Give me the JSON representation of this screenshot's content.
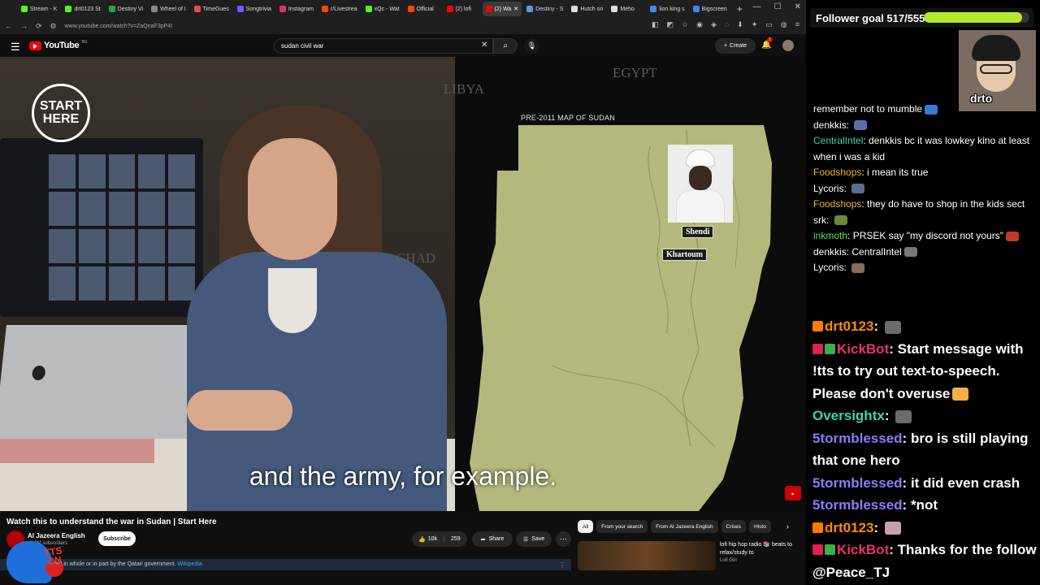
{
  "browser": {
    "tabs": [
      {
        "label": "Stream - K",
        "color": "#53fc18"
      },
      {
        "label": "drt0123 St",
        "color": "#53fc18"
      },
      {
        "label": "Destiny Vi",
        "color": "#26a641"
      },
      {
        "label": "Wheel of I",
        "color": "#888888"
      },
      {
        "label": "TimeGues",
        "color": "#e24c4c"
      },
      {
        "label": "Songtrivia",
        "color": "#6b5cff"
      },
      {
        "label": "Instagram",
        "color": "#e1306c"
      },
      {
        "label": "r/Livestrea",
        "color": "#ff4500"
      },
      {
        "label": "xQc - Wat",
        "color": "#53fc18"
      },
      {
        "label": "Official",
        "color": "#ff4500"
      },
      {
        "label": "(2) lofi",
        "color": "#ff0000"
      },
      {
        "label": "(2) Wa",
        "color": "#ff0000",
        "active": true
      },
      {
        "label": "Destiny - S",
        "color": "#5b9bd5"
      },
      {
        "label": "Hutch on",
        "color": "#dddddd"
      },
      {
        "label": "Meho",
        "color": "#dddddd"
      },
      {
        "label": "lion king s",
        "color": "#4285f4"
      },
      {
        "label": "Bigscreen",
        "color": "#4285f4"
      }
    ],
    "url": "www.youtube.com/watch?v=ZaQnaF3pP4I"
  },
  "youtube": {
    "logo_text": "YouTube",
    "logo_country": "BG",
    "search_value": "sudan civil war",
    "create_label": "Create",
    "notif_count": "2"
  },
  "video": {
    "start_here": [
      "START",
      "HERE"
    ],
    "map_caption": "PRE-2011 MAP OF SUDAN",
    "map_labels": {
      "libya": "LIBYA",
      "egypt": "EGYPT",
      "chad": "CHAD"
    },
    "cities": {
      "shendi": "Shendi",
      "khartoum": "Khartoum"
    },
    "subtitle": "and the army, for example."
  },
  "below": {
    "title": "Watch this to understand the war in Sudan | Start Here",
    "channel": "Al Jazeera English",
    "subscribers": "18.2M subscribers",
    "subscribe_label": "Subscribe",
    "likes": "10k",
    "dislikes": "259",
    "share_label": "Share",
    "save_label": "Save",
    "notice_text": "is funded in whole or in part by the Qatari government.",
    "notice_link": "Wikipedia",
    "chips": [
      "All",
      "From your search",
      "From Al Jazeera English",
      "Crises",
      "Histo"
    ],
    "rec_title": "lofi hip hop radio 📚 beats to relax/study to",
    "rec_channel": "Lofi Girl"
  },
  "overlay": {
    "tts_text": "TTS ON",
    "follower_goal": "Follower goal 517/555",
    "follower_progress": 0.93,
    "webcam_name": "drto"
  },
  "chat_top": [
    {
      "user": "",
      "color": "#ffffff",
      "text": "remember not to mumble",
      "emote": "#3a7bd5"
    },
    {
      "user": "denkkis",
      "color": "#ffffff",
      "text": "",
      "emote": "#5a6fb0"
    },
    {
      "user": "CentralIntel",
      "color": "#3fd2b3",
      "text": "denkkis bc it was lowkey kino at least when i was a kid",
      "emote": ""
    },
    {
      "user": "Foodshops",
      "color": "#f2b134",
      "text": "i mean its true",
      "emote": ""
    },
    {
      "user": "Lycoris",
      "color": "#ffffff",
      "text": "",
      "emote": "#5d6e8a"
    },
    {
      "user": "Foodshops",
      "color": "#f2b134",
      "text": "they do have to shop in the kids sect",
      "emote": ""
    },
    {
      "user": "srk",
      "color": "#ffffff",
      "text": "",
      "emote": "#6a8a3a"
    },
    {
      "user": "inkmoth",
      "color": "#53e84f",
      "text": "PRSEK say \"my discord not yours\"",
      "emote": "#c0392b"
    },
    {
      "user": "denkkis",
      "color": "#ffffff",
      "text": "CentralIntel",
      "emote": "#777777"
    },
    {
      "user": "Lycoris",
      "color": "#ffffff",
      "text": "",
      "emote": "#8a6a5a"
    }
  ],
  "chat_bottom": [
    {
      "badges": [
        "#ff7a00"
      ],
      "user": "drt0123",
      "color": "#ff8c00",
      "text": "",
      "emote": "#6b6b6b"
    },
    {
      "badges": [
        "#e02050",
        "#3cb043"
      ],
      "user": "KickBot",
      "color": "#e8336b",
      "text": "Start message with !tts to try out text-to-speech. Please don't overuse",
      "emote": "#f5b041"
    },
    {
      "badges": [],
      "user": "Oversightx",
      "color": "#3ed6a0",
      "text": "",
      "emote": "#6b6b6b"
    },
    {
      "badges": [],
      "user": "5tormblessed",
      "color": "#8a7cff",
      "text": "bro is still playing that one hero",
      "emote": ""
    },
    {
      "badges": [],
      "user": "5tormblessed",
      "color": "#8a7cff",
      "text": "it did even crash",
      "emote": ""
    },
    {
      "badges": [],
      "user": "5tormblessed",
      "color": "#8a7cff",
      "text": "*not",
      "emote": ""
    },
    {
      "badges": [
        "#ff7a00"
      ],
      "user": "drt0123",
      "color": "#ff8c00",
      "text": "",
      "emote": "#c9a0b0"
    },
    {
      "badges": [
        "#e02050",
        "#3cb043"
      ],
      "user": "KickBot",
      "color": "#e8336b",
      "text": "Thanks for the follow @Peace_TJ",
      "emote": ""
    }
  ]
}
